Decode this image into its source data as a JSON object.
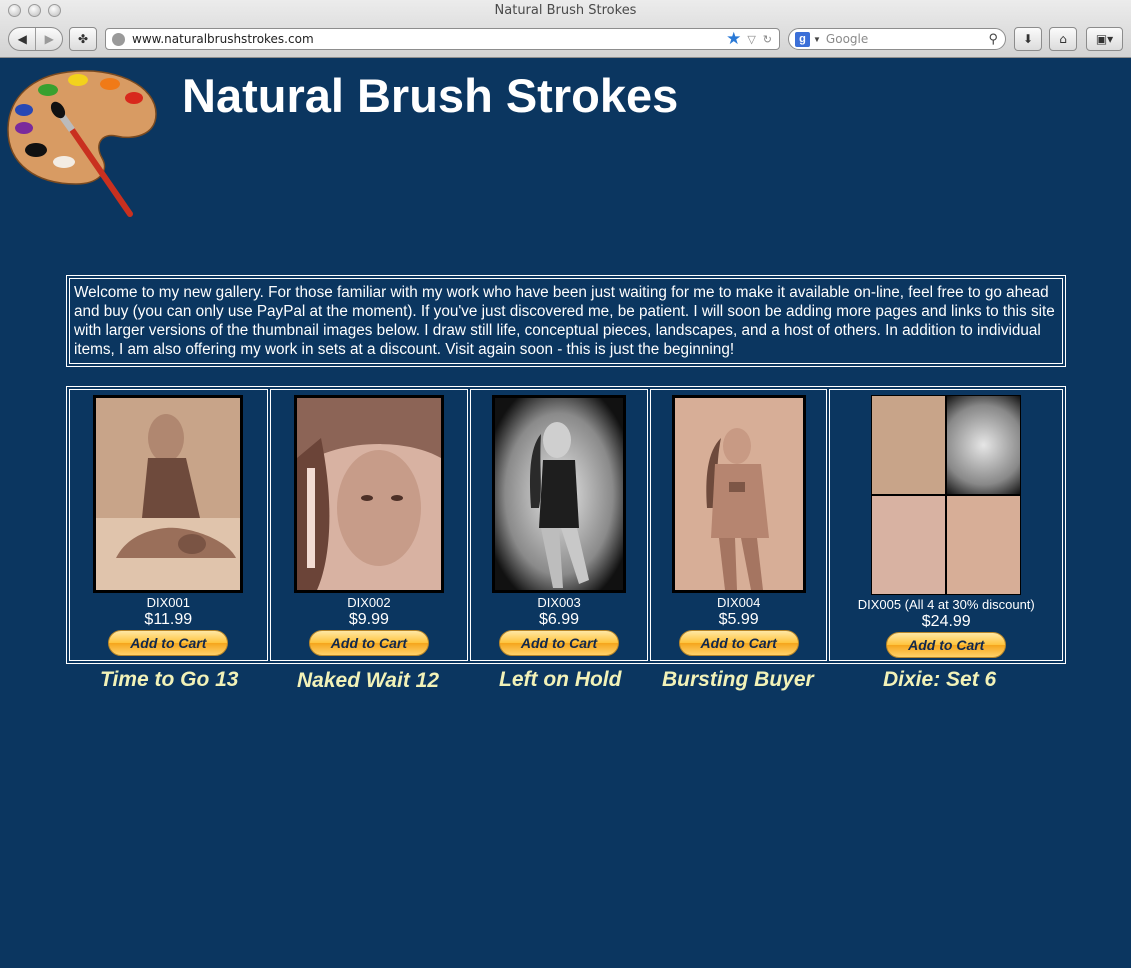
{
  "browser": {
    "window_title": "Natural Brush Strokes",
    "url": "www.naturalbrushstrokes.com",
    "search_placeholder": "Google",
    "search_engine_icon": "google-icon"
  },
  "page": {
    "site_title": "Natural Brush Strokes",
    "welcome_text": "Welcome to my new gallery. For those familiar with my work who have been just waiting for me to make it available on-line, feel free to go ahead and buy (you can only use PayPal at the moment). If you've just discovered me, be patient. I will soon be adding more pages and links to this site with larger versions of the thumbnail images below. I draw still life, conceptual pieces, landscapes, and a host of others. In addition to individual items, I am also offering my work in sets at a discount. Visit again soon - this is just the beginning!",
    "colors": {
      "background": "#0b3660",
      "title_text": "#ffffff",
      "item_names": "#f2f2b8"
    },
    "items": [
      {
        "sku": "DIX001",
        "price": "$11.99",
        "button": "Add to Cart",
        "name": "Time to Go 13"
      },
      {
        "sku": "DIX002",
        "price": "$9.99",
        "button": "Add to Cart",
        "name": "Naked Wait 12"
      },
      {
        "sku": "DIX003",
        "price": "$6.99",
        "button": "Add to Cart",
        "name": "Left on Hold"
      },
      {
        "sku": "DIX004",
        "price": "$5.99",
        "button": "Add to Cart",
        "name": "Bursting Buyer"
      },
      {
        "sku": "DIX005 (All 4 at 30% discount)",
        "price": "$24.99",
        "button": "Add to Cart",
        "name": "Dixie: Set 6"
      }
    ]
  }
}
